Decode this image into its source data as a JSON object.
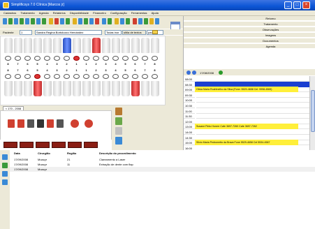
{
  "window": {
    "title": "Simplificsys 7.0 Clínica [Marcos jr]",
    "controls": [
      "_",
      "□",
      "×"
    ]
  },
  "menu": [
    "Cadastros",
    "Tratamento",
    "Agenda",
    "Relatórios",
    "Disponibilidade",
    "Financeiro",
    "Configuração",
    "Ferramentas",
    "Ajuda"
  ],
  "patient": {
    "label": "Paciente",
    "id": "1",
    "name": "Sandra Regina Bortolozzo Hernández",
    "filter_value": "Todas inor",
    "filter_button": "ultila de textos",
    "dropdown_value": "pad",
    "time": "11:11"
  },
  "odontogram": {
    "upper_numbers": [
      "8",
      "7",
      "6",
      "5",
      "4",
      "3",
      "2",
      "1",
      "1",
      "2",
      "3",
      "4",
      "5",
      "6",
      "7",
      "8"
    ],
    "lower_numbers": [
      "8",
      "7",
      "6",
      "5",
      "4",
      "3",
      "2",
      "1",
      "1",
      "2",
      "3",
      "4",
      "5",
      "6",
      "7",
      "8"
    ]
  },
  "tabs": {
    "active": "< 170 - 2008"
  },
  "right_panel": {
    "nav": [
      "Retorno",
      "Tratamento",
      "Observações",
      "Imagens",
      "Documentos",
      "Agenda"
    ],
    "date": "17/08/2008"
  },
  "schedule": [
    {
      "time": "08:00",
      "desc": "",
      "color": "#ffffff"
    },
    {
      "time": "08:30",
      "desc": "",
      "color": "#1a3fd0"
    },
    {
      "time": "09:00",
      "desc": "Olivia Maria Rodrimelho da Silva (Fone: 5529-4658 Cel: 9998-4569)",
      "color": "#ffef3a"
    },
    {
      "time": "09:30",
      "desc": "",
      "color": "#ffffff"
    },
    {
      "time": "10:00",
      "desc": "",
      "color": "#ffffff"
    },
    {
      "time": "10:30",
      "desc": "",
      "color": "#ffffff"
    },
    {
      "time": "11:00",
      "desc": "",
      "color": "#ffffff"
    },
    {
      "time": "11:30",
      "desc": "",
      "color": "#ffffff"
    },
    {
      "time": "12:00",
      "desc": "",
      "color": "#ffffff"
    },
    {
      "time": "13:00",
      "desc": "Susane Pinto Honerr Cafe 3697-7260 Cafe 3697-7262",
      "color": "#ffef3a"
    },
    {
      "time": "14:00",
      "desc": "",
      "color": "#ffffff"
    },
    {
      "time": "14:30",
      "desc": "",
      "color": "#ffffff"
    },
    {
      "time": "15:00",
      "desc": "Silvio Maria Pedrometto da Brava Fone 5529-4658 Cel 5534-4567",
      "color": "#ffef3a"
    },
    {
      "time": "16:00",
      "desc": "",
      "color": "#ffffff"
    },
    {
      "time": "16:30",
      "desc": "Luiz Sergio Rodrigues Fone 3376-1717 Cel 9883-2774",
      "color": "#ffef3a"
    },
    {
      "time": "17:30",
      "desc": "Fernando Antonio Lopes Fernandes Fone 9546-5803 Cel 9196-3318",
      "color": "#ffef3a"
    },
    {
      "time": "18:00",
      "desc": "Fábio Maria Macedo Fone 7285-6658 Cafe 7285-7774",
      "color": "#ffef3a"
    }
  ],
  "procedures": {
    "headers": [
      "Data",
      "Cirurgião",
      "Região",
      "Descrição do procedimento"
    ],
    "rows": [
      {
        "date": "17/09/2008",
        "surgeon": "Moacyr",
        "region": "21",
        "desc": "Clareamento a Laser"
      },
      {
        "date": "17/09/2008",
        "surgeon": "Moacyr",
        "region": "11",
        "desc": "Extração de dente com flap"
      },
      {
        "date": "17/09/2008",
        "surgeon": "Moacyr",
        "region": "",
        "desc": ""
      }
    ]
  },
  "icons": {
    "toolbar": [
      "new-icon",
      "open-icon",
      "save-icon",
      "patient-icon",
      "calendar-icon",
      "tooth-icon",
      "report-icon",
      "money-icon",
      "settings-icon",
      "help-icon"
    ],
    "panel": [
      "printer-icon",
      "chart-icon",
      "phone-icon",
      "document-icon",
      "note-icon",
      "glasses-icon",
      "tooth-chart-icon",
      "pill-icon"
    ],
    "mid": [
      "ledger-icon",
      "image-icon",
      "exam-icon",
      "photo-icon"
    ],
    "low": [
      "list-icon",
      "edit-icon",
      "delete-icon",
      "print-icon"
    ]
  },
  "colors": {
    "titlebar": "#0c55d6",
    "highlight_slot": "#1a3fd0",
    "appointment": "#ffef3a",
    "strip_button": "#8a1e14",
    "selected_tooth_marker": "#d33333"
  }
}
